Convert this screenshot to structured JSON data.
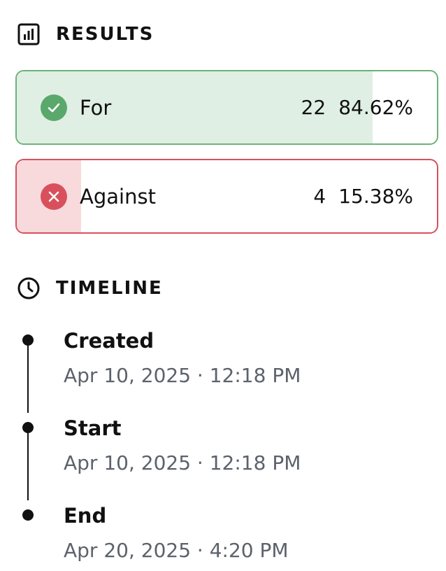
{
  "results": {
    "title": "RESULTS",
    "icon": "bar-chart-icon",
    "options": [
      {
        "label": "For",
        "count": "22",
        "percent": "84.62%",
        "fraction": 0.8462,
        "icon": "check-circle-icon",
        "color": "#5aa86c"
      },
      {
        "label": "Against",
        "count": "4",
        "percent": "15.38%",
        "fraction": 0.1538,
        "icon": "x-circle-icon",
        "color": "#d9505d"
      }
    ]
  },
  "timeline": {
    "title": "TIMELINE",
    "icon": "clock-icon",
    "events": [
      {
        "label": "Created",
        "date": "Apr 10, 2025 · 12:18 PM"
      },
      {
        "label": "Start",
        "date": "Apr 10, 2025 · 12:18 PM"
      },
      {
        "label": "End",
        "date": "Apr 20, 2025 · 4:20 PM"
      }
    ]
  }
}
